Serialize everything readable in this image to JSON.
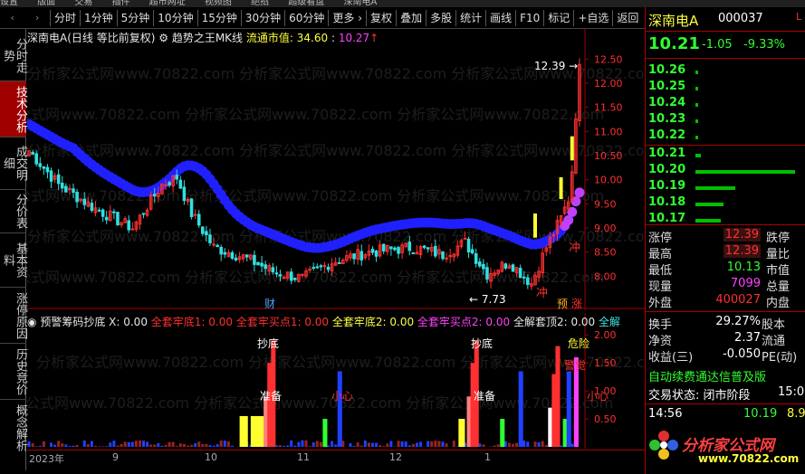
{
  "top_menu": [
    "设置",
    "版面",
    "交易",
    "插件",
    "超市网址",
    "视频图",
    "绝招",
    "超级看盘",
    "深南电A"
  ],
  "toolbar": {
    "items": [
      "分时",
      "1分钟",
      "5分钟",
      "10分钟",
      "15分钟",
      "30分钟",
      "60分钟",
      "更多 ›",
      "复权",
      "叠加",
      "多股",
      "统计",
      "画线",
      "F10",
      "标记",
      "+自选",
      "返回"
    ]
  },
  "left_tabs": [
    "分时走势",
    "技术分析",
    "成交明细",
    "分价表",
    "基本资料",
    "涨停原因",
    "历史竞价",
    "概念解析"
  ],
  "main_header": {
    "title": "深南电A(日线 等比前复权)",
    "indicator": "趋势之王MK线",
    "cap_label": "流通市值:",
    "cap_value": "34.60",
    "total_value": "10.27"
  },
  "price_labels": {
    "high": "12.39",
    "low": "7.73",
    "tag_cai": "财",
    "tag_chong1": "冲",
    "tag_chong2": "冲",
    "tag_yu": "预",
    "tag_zhang": "涨"
  },
  "y_axis_main": [
    "12.50",
    "12.00",
    "11.50",
    "11.00",
    "10.50",
    "10.00",
    "9.50",
    "9.00",
    "8.50",
    "8.00"
  ],
  "ind_header": {
    "name": "预警筹码抄底",
    "x_label": "X: 0.00",
    "s1": "全套牢底1: 0.00",
    "s2": "全套牢买点1: 0.00",
    "s3": "全套牢底2: 0.00",
    "s4": "全套牢买点2: 0.00",
    "s5": "全解套顶2: 0.00",
    "s6": "全解"
  },
  "ind_labels": {
    "chaodi1": "抄底",
    "zhunbei1": "准备",
    "xiaoxin1": "小心",
    "chaodi2": "抄底",
    "zhunbei2": "准备",
    "xiaoxin2": "小心",
    "weixian": "危险",
    "jingjue": "警觉"
  },
  "y_axis_ind": [
    "2.00",
    "1.50",
    "1.00",
    "0.50"
  ],
  "date_axis": [
    "2023年",
    "9",
    "10",
    "11",
    "12",
    "1"
  ],
  "watermark": "分析家公式网www.70822.com",
  "right_panel": {
    "stock_name": "深南电A",
    "stock_code": "000037",
    "price": "10.21",
    "change": "-1.05",
    "change_pct": "-9.33%",
    "sell_book": [
      {
        "price": "10.26",
        "vol": 2
      },
      {
        "price": "10.25",
        "vol": 3
      },
      {
        "price": "10.24",
        "vol": 2
      },
      {
        "price": "10.23",
        "vol": 2
      },
      {
        "price": "10.22",
        "vol": 3
      }
    ],
    "buy_book": [
      {
        "price": "10.21",
        "vol": 5
      },
      {
        "price": "10.20",
        "vol": 100
      },
      {
        "price": "10.19",
        "vol": 40
      },
      {
        "price": "10.18",
        "vol": 28
      },
      {
        "price": "10.17",
        "vol": 25
      }
    ],
    "stats": [
      {
        "l1": "涨停",
        "v1": "12.39",
        "l2": "跌停"
      },
      {
        "l1": "最高",
        "v1": "12.39",
        "l2": "量比"
      },
      {
        "l1": "最低",
        "v1": "10.13",
        "l2": "市值"
      },
      {
        "l1": "现量",
        "v1": "7099",
        "l2": "总量"
      },
      {
        "l1": "外盘",
        "v1": "400027",
        "l2": "内盘"
      }
    ],
    "fin": [
      {
        "l1": "换手",
        "v1": "29.27%",
        "l2": "股本"
      },
      {
        "l1": "净资",
        "v1": "2.37",
        "l2": "流通"
      },
      {
        "l1": "收益(三)",
        "v1": "-0.050",
        "l2": "PE(动)"
      }
    ],
    "promo": "自动续费通达信普及版",
    "trade_status": "交易状态: 闭市阶段",
    "trade_time": "15:0",
    "tick": {
      "time": "14:56",
      "price": "10.19",
      "vol": "8.9"
    },
    "logo_text": "分析家公式网",
    "logo_url": "www.70822.com"
  },
  "colors": {
    "up": "#ff3030",
    "down": "#30e0e0",
    "ma": "#2020ff",
    "accent": "#a00000"
  }
}
